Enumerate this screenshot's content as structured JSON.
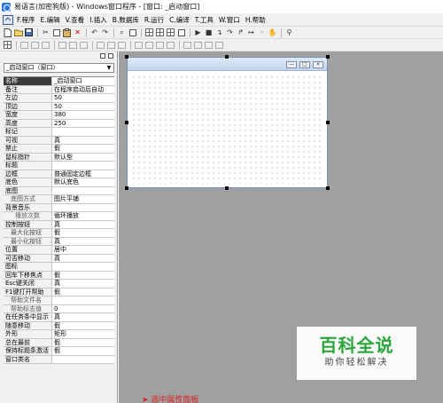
{
  "window": {
    "title": "易语言(加密狗版) - Windows窗口程序 - [窗口: _启动窗口]"
  },
  "menu": [
    "F.程序",
    "E.编辑",
    "V.查看",
    "I.插入",
    "B.数据库",
    "R.运行",
    "C.编译",
    "T.工具",
    "W.窗口",
    "H.帮助"
  ],
  "properties": {
    "object_combo": "_启动窗口（窗口）",
    "rows": [
      {
        "name": "名称",
        "value": "_启动窗口",
        "level": 0,
        "selected": true
      },
      {
        "name": "备注",
        "value": "在程序启动后自动",
        "level": 0
      },
      {
        "name": "左边",
        "value": "50",
        "level": 0
      },
      {
        "name": "顶边",
        "value": "50",
        "level": 0
      },
      {
        "name": "宽度",
        "value": "380",
        "level": 0
      },
      {
        "name": "高度",
        "value": "250",
        "level": 0
      },
      {
        "name": "标记",
        "value": "",
        "level": 0
      },
      {
        "name": "可视",
        "value": "真",
        "level": 0
      },
      {
        "name": "禁止",
        "value": "假",
        "level": 0
      },
      {
        "name": "鼠标指针",
        "value": "默认型",
        "level": 0
      },
      {
        "name": "标题",
        "value": "",
        "level": 0
      },
      {
        "name": "边框",
        "value": "普通固定边框",
        "level": 0
      },
      {
        "name": "底色",
        "value": "默认底色",
        "level": 0
      },
      {
        "name": "底图",
        "value": "",
        "level": 0
      },
      {
        "name": "底图方式",
        "value": "图片平铺",
        "level": 1
      },
      {
        "name": "背景音乐",
        "value": "",
        "level": 0
      },
      {
        "name": "播放次数",
        "value": "循环播放",
        "level": 2
      },
      {
        "name": "控制按钮",
        "value": "真",
        "level": 0
      },
      {
        "name": "最大化按钮",
        "value": "假",
        "level": 1
      },
      {
        "name": "最小化按钮",
        "value": "真",
        "level": 1
      },
      {
        "name": "位置",
        "value": "居中",
        "level": 0
      },
      {
        "name": "可否移动",
        "value": "真",
        "level": 0
      },
      {
        "name": "图标",
        "value": "",
        "level": 0
      },
      {
        "name": "回车下移焦点",
        "value": "假",
        "level": 0
      },
      {
        "name": "Esc键关闭",
        "value": "真",
        "level": 0
      },
      {
        "name": "F1键打开帮助",
        "value": "假",
        "level": 0
      },
      {
        "name": "帮助文件名",
        "value": "",
        "level": 1
      },
      {
        "name": "帮助标志值",
        "value": "0",
        "level": 1
      },
      {
        "name": "在任务条中显示",
        "value": "真",
        "level": 0
      },
      {
        "name": "随意移动",
        "value": "假",
        "level": 0
      },
      {
        "name": "外形",
        "value": "矩形",
        "level": 0
      },
      {
        "name": "总在最前",
        "value": "假",
        "level": 0
      },
      {
        "name": "保持标题条激活",
        "value": "假",
        "level": 0
      },
      {
        "name": "窗口类名",
        "value": "",
        "level": 0
      }
    ]
  },
  "design_window": {
    "min_symbol": "—",
    "max_symbol": "□",
    "close_symbol": "×"
  },
  "watermark": {
    "brand": "百科全说",
    "slogan": "助你轻松解决"
  },
  "annotation": {
    "text": "选中属性面板"
  }
}
